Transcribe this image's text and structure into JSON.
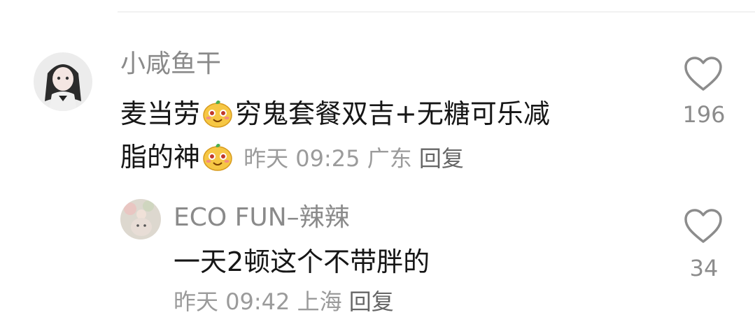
{
  "comment": {
    "username": "小咸鱼干",
    "text_part1": "麦当劳",
    "text_part2": "穷鬼套餐双吉+无糖可乐减",
    "text_part3": "脂的神",
    "time": "昨天 09:25",
    "location": "广东",
    "reply_label": "回复",
    "like_count": "196",
    "emoji_icon": "smirk-emoji-icon"
  },
  "reply": {
    "username": "ECO FUN–辣辣",
    "text": "一天2顿这个不带胖的",
    "time": "昨天 09:42",
    "location": "上海",
    "reply_label": "回复",
    "like_count": "34"
  },
  "colors": {
    "username": "#8a8a8a",
    "text": "#161616",
    "meta": "#9b9b9b",
    "emoji_face": "#f6c744"
  }
}
